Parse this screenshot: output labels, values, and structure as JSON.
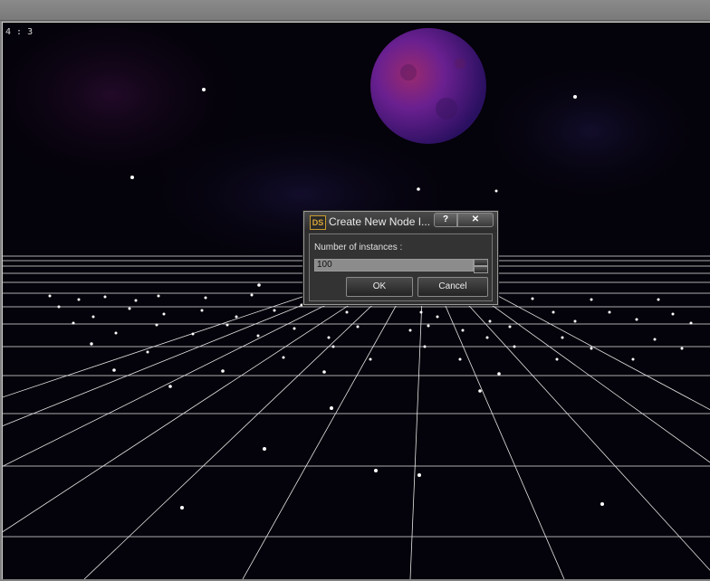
{
  "viewport": {
    "aspect_label": "4 : 3"
  },
  "dialog": {
    "logo_text": "DS",
    "title": "Create New Node I...",
    "help_label": "?",
    "close_label": "✕",
    "field_label": "Number of instances :",
    "instances_value": "100",
    "ok_label": "OK",
    "cancel_label": "Cancel"
  },
  "colors": {
    "viewport_bg": "#04020a",
    "grid_line": "#e6e6e6",
    "moon_glow": "#c0206a",
    "dialog_bg": "#2f2f2f"
  }
}
